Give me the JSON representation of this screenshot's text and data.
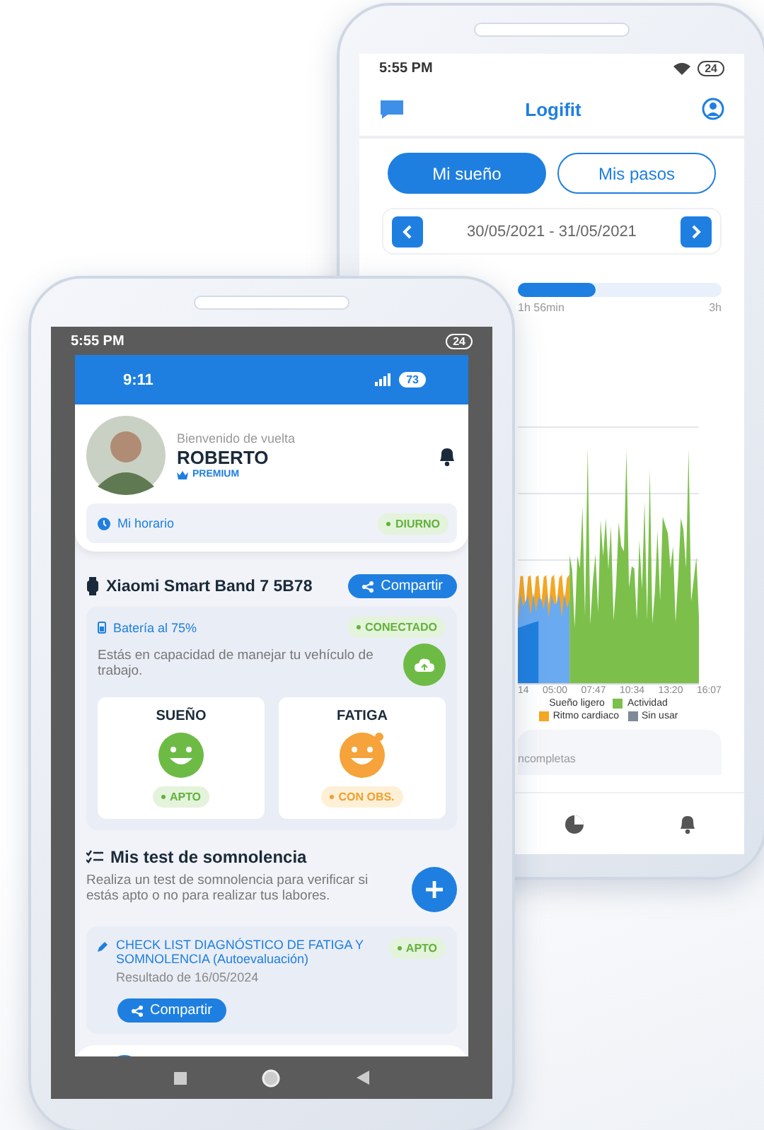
{
  "back_phone": {
    "status_time": "5:55 PM",
    "battery": "24",
    "title": "Logifit",
    "tabs": [
      {
        "label": "Mi sueño",
        "selected": true
      },
      {
        "label": "Mis pasos",
        "selected": false
      }
    ],
    "date_range": "30/05/2021 - 31/05/2021",
    "sleep_bar": {
      "level": 0.38,
      "value": "1h 56min",
      "max": "3h"
    },
    "chart_x_labels": [
      "14",
      "05:00",
      "07:47",
      "10:34",
      "13:20",
      "16:07"
    ],
    "legend": [
      {
        "label": "Sueño ligero"
      },
      {
        "label": "Actividad",
        "color": "#7cc04b"
      },
      {
        "label": "Ritmo cardiaco",
        "color": "#f5a623"
      },
      {
        "label": "Sin usar",
        "color": "#7f8a99"
      }
    ],
    "card_text": "ncompletas"
  },
  "front_phone": {
    "status_time": "5:55 PM",
    "battery": "24",
    "app_status": {
      "time": "9:11",
      "battery": "73"
    },
    "profile": {
      "greeting": "Bienvenido de vuelta",
      "name": "ROBERTO",
      "badge": "PREMIUM"
    },
    "schedule": {
      "label": "Mi horario",
      "status": "DIURNO"
    },
    "device": {
      "name": "Xiaomi Smart Band 7 5B78",
      "share": "Compartir",
      "battery": "Batería al 75%",
      "status": "CONECTADO",
      "message": "Estás en capacidad de manejar tu vehículo de trabajo.",
      "indicators": [
        {
          "title": "SUEÑO",
          "status": "APTO",
          "kind": "ok"
        },
        {
          "title": "FATIGA",
          "status": "CON OBS.",
          "kind": "warning"
        }
      ]
    },
    "tests": {
      "title": "Mis test de somnolencia",
      "description": "Realiza un test de somnolencia para verificar si estás apto o no para realizar tus labores.",
      "results": [
        {
          "title": "CHECK LIST DIAGNÓSTICO DE FATIGA Y SOMNOLENCIA (Autoevaluación)",
          "date": "Resultado de 16/05/2024",
          "status": "APTO",
          "share": "Compartir"
        }
      ]
    }
  }
}
